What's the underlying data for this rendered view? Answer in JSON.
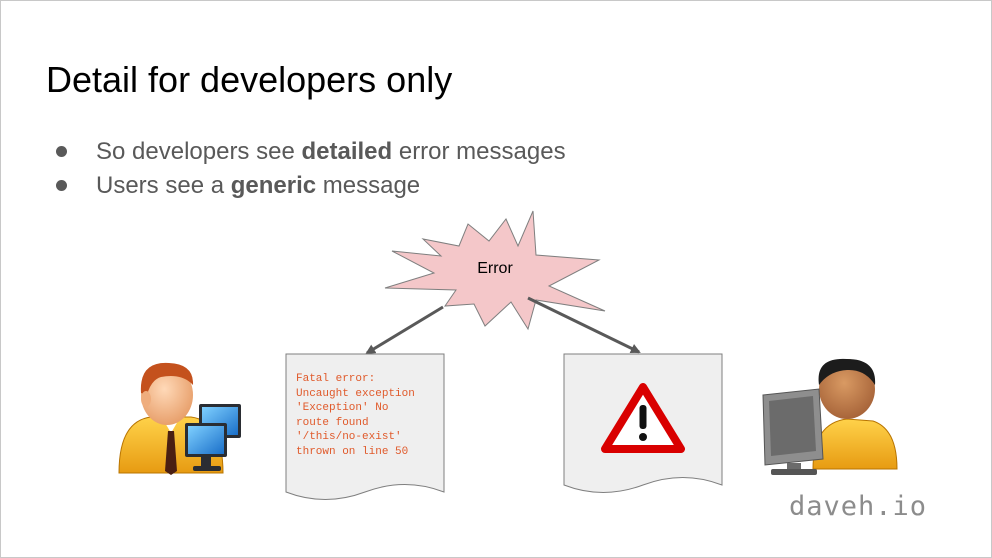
{
  "slide": {
    "title": "Detail for developers only",
    "bullets": [
      {
        "pre": "So developers see ",
        "bold": "detailed",
        "post": " error messages"
      },
      {
        "pre": "Users see a ",
        "bold": "generic",
        "post": " message"
      }
    ]
  },
  "diagram": {
    "burst_label": "Error",
    "developer_doc_text": "Fatal error:\nUncaught exception\n'Exception' No\nroute found\n'/this/no-exist'\nthrown on line 50",
    "user_doc_icon": "warning-triangle-icon",
    "developer_icon": "developer-at-computer-icon",
    "user_icon": "user-at-computer-icon"
  },
  "footer": {
    "brand": "daveh.io"
  },
  "colors": {
    "burst_fill": "#f4c7c9",
    "doc_fill": "#efefef",
    "error_text": "#e05a2b",
    "warning_red": "#d90000",
    "arrow": "#595959"
  }
}
